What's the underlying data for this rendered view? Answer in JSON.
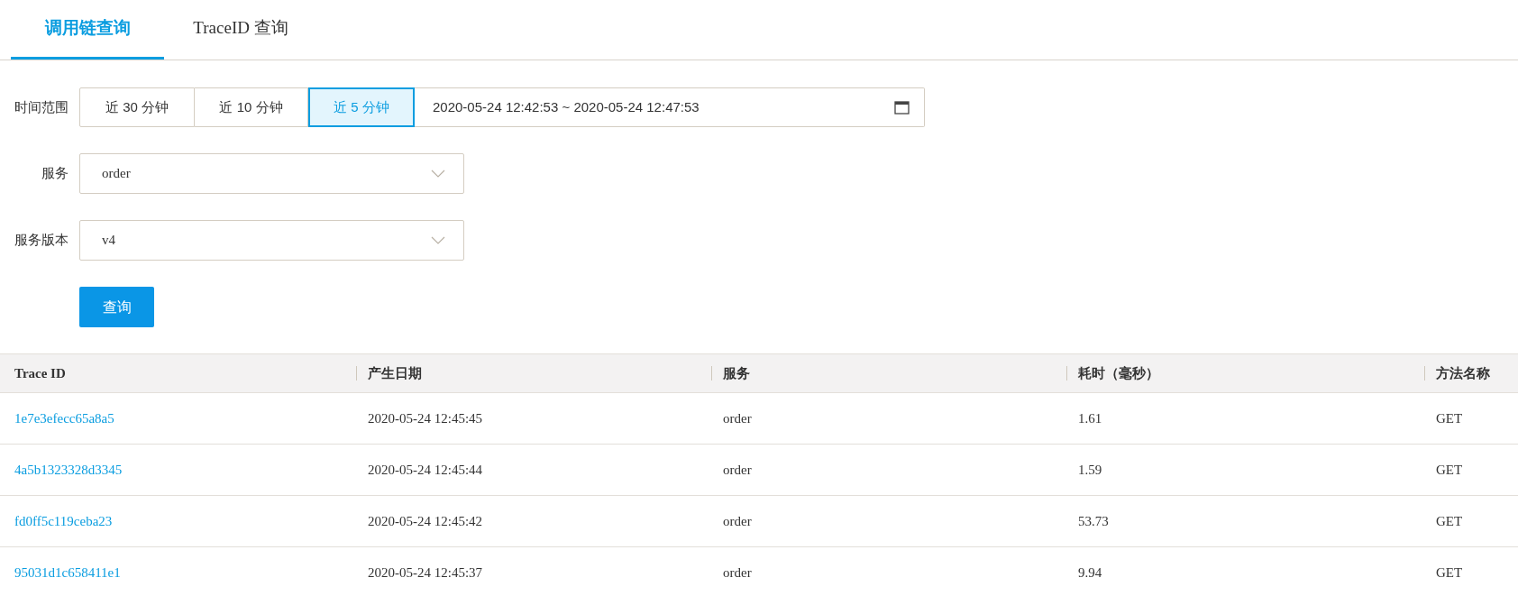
{
  "tabs": [
    {
      "label": "调用链查询",
      "selected": true
    },
    {
      "label": "TraceID 查询",
      "selected": false
    }
  ],
  "time_range": {
    "label": "时间范围",
    "presets": [
      {
        "label": "近 30 分钟",
        "selected": false
      },
      {
        "label": "近 10 分钟",
        "selected": false
      },
      {
        "label": "近 5 分钟",
        "selected": true
      }
    ],
    "value": "2020-05-24 12:42:53 ~ 2020-05-24 12:47:53"
  },
  "service": {
    "label": "服务",
    "value": "order"
  },
  "service_version": {
    "label": "服务版本",
    "value": "v4"
  },
  "query_button": "查询",
  "table": {
    "columns": [
      "Trace ID",
      "产生日期",
      "服务",
      "耗时（毫秒）",
      "方法名称"
    ],
    "rows": [
      [
        "1e7e3efecc65a8a5",
        "2020-05-24 12:45:45",
        "order",
        "1.61",
        "GET"
      ],
      [
        "4a5b1323328d3345",
        "2020-05-24 12:45:44",
        "order",
        "1.59",
        "GET"
      ],
      [
        "fd0ff5c119ceba23",
        "2020-05-24 12:45:42",
        "order",
        "53.73",
        "GET"
      ],
      [
        "95031d1c658411e1",
        "2020-05-24 12:45:37",
        "order",
        "9.94",
        "GET"
      ]
    ]
  }
}
